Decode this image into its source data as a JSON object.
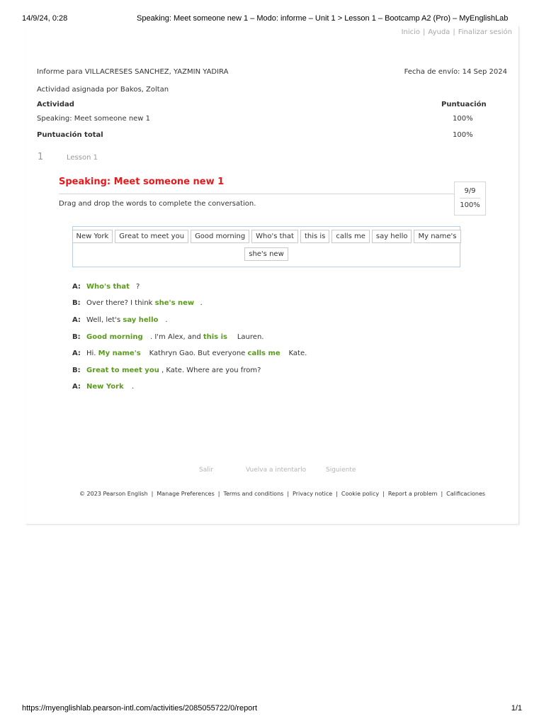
{
  "print": {
    "datetime": "14/9/24, 0:28",
    "title": "Speaking: Meet someone new 1 – Modo: informe – Unit 1 > Lesson 1 – Bootcamp A2 (Pro) – MyEnglishLab",
    "url": "https://myenglishlab.pearson-intl.com/activities/2085055722/0/report",
    "pages": "1/1"
  },
  "toplinks": {
    "home": "Inicio",
    "help": "Ayuda",
    "logout": "Finalizar sesión",
    "sep": "|"
  },
  "report": {
    "for": "Informe para VILLACRESES SANCHEZ, YAZMIN YADIRA",
    "sent": "Fecha de envío: 14 Sep 2024",
    "assigned_by": "Actividad asignada por Bakos, Zoltan",
    "col_activity": "Actividad",
    "col_score": "Puntuación",
    "activity_name": "Speaking: Meet someone new 1",
    "activity_score": "100%",
    "total_label": "Puntuación total",
    "total_score": "100%"
  },
  "lesson": {
    "number": "1",
    "label": "Lesson 1"
  },
  "activity": {
    "title": "Speaking: Meet someone new 1",
    "score_fraction": "9/9",
    "score_percent": "100%",
    "instruction": "Drag and drop the words to complete the conversation."
  },
  "word_bank": {
    "row1": [
      "New York",
      "Great to meet you",
      "Good morning",
      "Who's that",
      "this is",
      "calls me",
      "say hello",
      "My name's"
    ],
    "row2": [
      "she's new"
    ]
  },
  "dialogue": [
    {
      "speaker": "A:",
      "parts": [
        {
          "t": "Who's that",
          "a": true
        },
        {
          "t": "?",
          "a": false
        }
      ]
    },
    {
      "speaker": "B:",
      "parts": [
        {
          "t": "Over there? I think",
          "a": false
        },
        {
          "t": "she's new",
          "a": true
        },
        {
          "t": ".",
          "a": false
        }
      ]
    },
    {
      "speaker": "A:",
      "parts": [
        {
          "t": "Well, let's",
          "a": false
        },
        {
          "t": "say hello",
          "a": true
        },
        {
          "t": ".",
          "a": false
        }
      ]
    },
    {
      "speaker": "B:",
      "parts": [
        {
          "t": "Good morning",
          "a": true
        },
        {
          "t": ". I'm Alex, and",
          "a": false
        },
        {
          "t": "this is",
          "a": true
        },
        {
          "t": "Lauren.",
          "a": false
        }
      ]
    },
    {
      "speaker": "A:",
      "parts": [
        {
          "t": "Hi.",
          "a": false
        },
        {
          "t": "My name's",
          "a": true
        },
        {
          "t": "Kathryn Gao. But everyone",
          "a": false
        },
        {
          "t": "calls me",
          "a": true
        },
        {
          "t": "Kate.",
          "a": false
        }
      ]
    },
    {
      "speaker": "B:",
      "parts": [
        {
          "t": "Great to meet you",
          "a": true
        },
        {
          "t": ", Kate. Where are you from?",
          "a": false
        }
      ]
    },
    {
      "speaker": "A:",
      "parts": [
        {
          "t": "New York",
          "a": true
        },
        {
          "t": ".",
          "a": false
        }
      ]
    }
  ],
  "nav": {
    "exit": "Salir",
    "retry": "Vuelva a intentarlo",
    "next": "Siguiente"
  },
  "footer": {
    "copyright": "© 2023 Pearson English",
    "links": [
      "Manage Preferences",
      "Terms and conditions",
      "Privacy notice",
      "Cookie policy",
      "Report a problem",
      "Calificaciones"
    ],
    "sep": "|"
  },
  "colors": {
    "title_red": "#e8191d",
    "answer_green": "#5b9a1e",
    "bank_border": "#b9cfe4"
  }
}
